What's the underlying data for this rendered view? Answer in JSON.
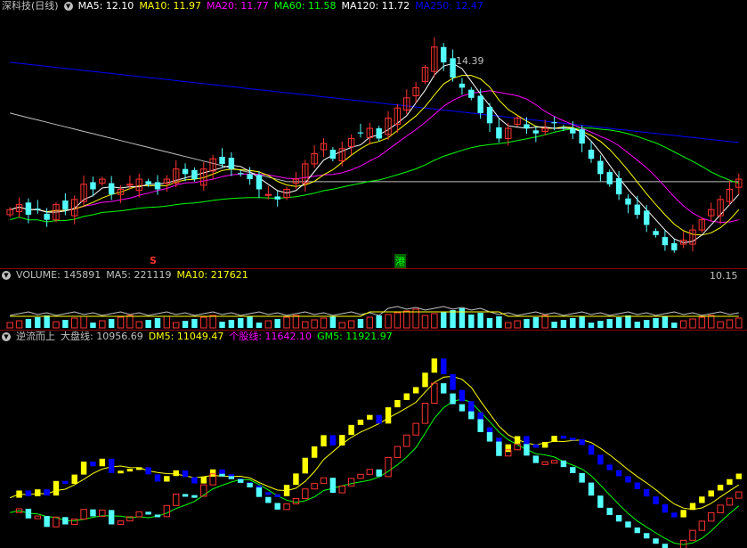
{
  "main_panel": {
    "title": "深科技(日线)",
    "ma": [
      {
        "label": "MA5: 12.10",
        "color": "#ffffff"
      },
      {
        "label": "MA10: 11.97",
        "color": "#ffff00"
      },
      {
        "label": "MA20: 11.77",
        "color": "#ff00ff"
      },
      {
        "label": "MA60: 11.58",
        "color": "#00ff00"
      },
      {
        "label": "MA120: 11.72",
        "color": "#ffffff"
      },
      {
        "label": "MA250: 12.47",
        "color": "#0000ff"
      }
    ],
    "high_label": "14.39",
    "low_label": "10.15",
    "marker_s": "S",
    "marker_gang": "港"
  },
  "volume_panel": {
    "title": "VOLUME: 145891",
    "ma5": "MA5: 221119",
    "ma10": "MA10: 217621"
  },
  "indicator_panel": {
    "name": "逆流而上",
    "dpx": "大盘线: 10956.69",
    "dm5": "DM5: 11049.47",
    "gg": "个股线: 11642.10",
    "gm5": "GM5: 11921.97"
  },
  "colors": {
    "up": "#ff3232",
    "down": "#54ffff",
    "bg": "#000000",
    "sep": "#8b0000"
  },
  "chart_data": {
    "type": "candlestick",
    "closes": [
      11.0,
      11.1,
      10.9,
      11.0,
      10.8,
      11.1,
      11.0,
      11.2,
      11.5,
      11.4,
      11.6,
      11.3,
      11.4,
      11.5,
      11.6,
      11.5,
      11.4,
      11.6,
      11.8,
      11.7,
      11.6,
      11.8,
      12.0,
      11.9,
      11.8,
      11.7,
      11.6,
      11.4,
      11.3,
      11.2,
      11.4,
      11.6,
      11.9,
      12.1,
      12.3,
      12.0,
      12.2,
      12.4,
      12.5,
      12.6,
      12.4,
      12.8,
      13.0,
      13.2,
      13.4,
      13.8,
      14.2,
      13.9,
      13.6,
      13.4,
      13.2,
      12.9,
      12.7,
      12.4,
      12.6,
      12.8,
      12.6,
      12.5,
      12.6,
      12.7,
      12.6,
      12.5,
      12.3,
      12.0,
      11.7,
      11.5,
      11.3,
      11.1,
      10.9,
      10.7,
      10.5,
      10.3,
      10.2,
      10.4,
      10.6,
      10.8,
      11.0,
      11.2,
      11.4,
      11.6
    ],
    "high": 14.39,
    "low": 10.15
  }
}
